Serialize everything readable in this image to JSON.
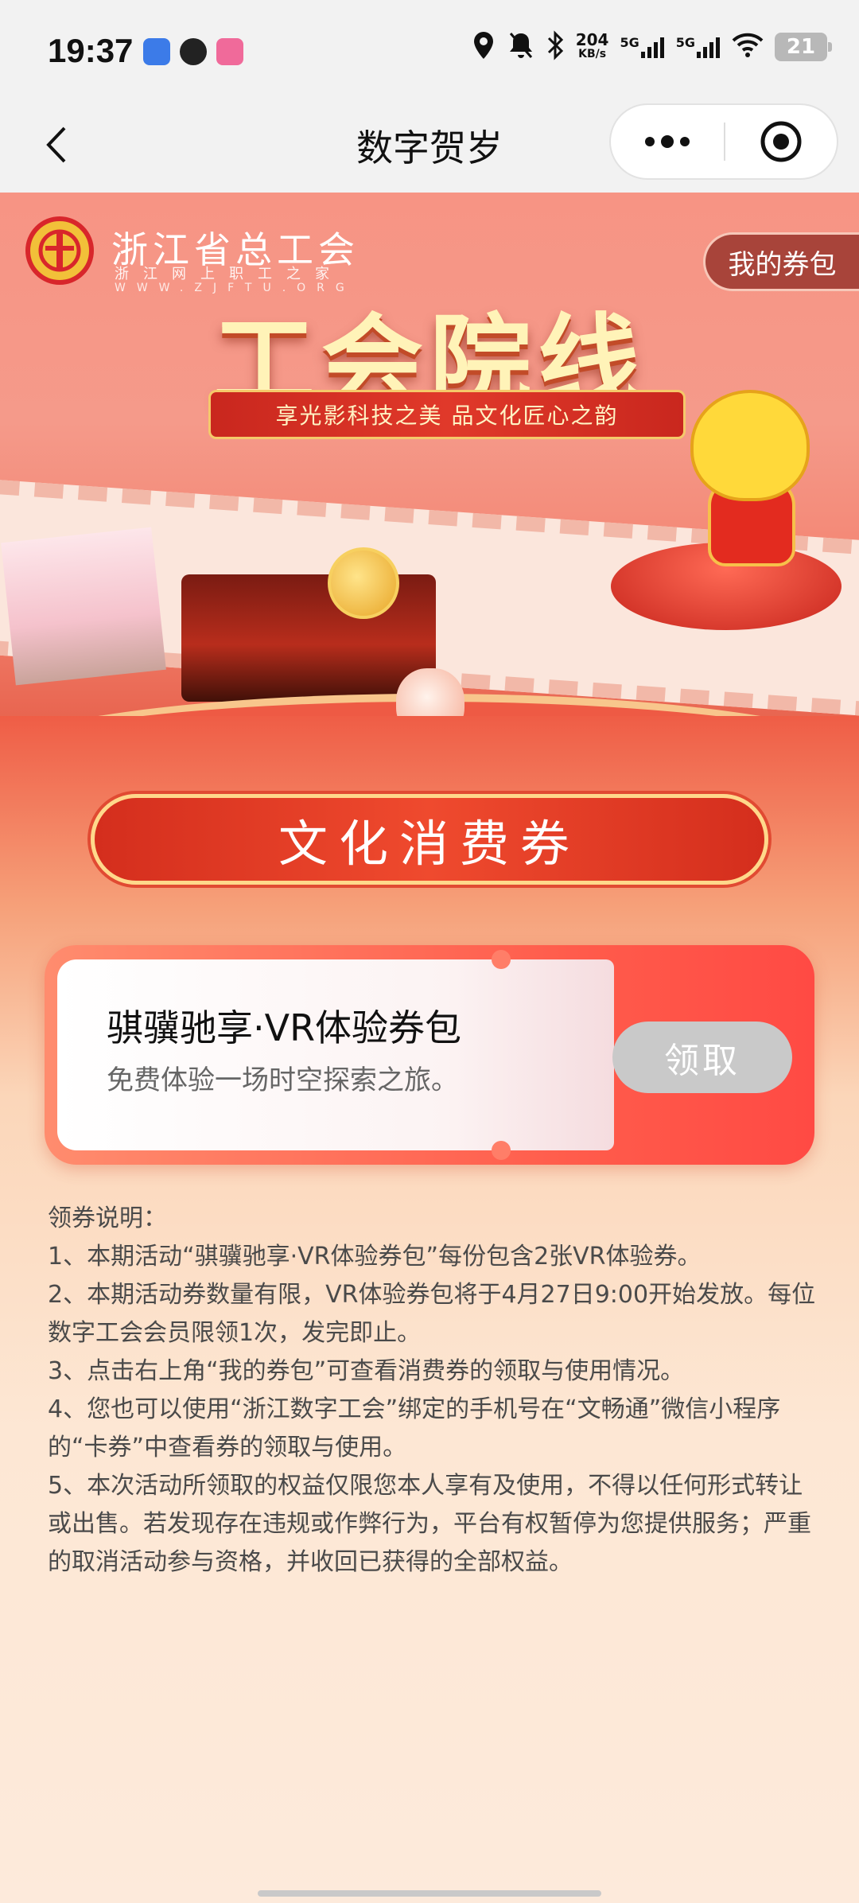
{
  "status_bar": {
    "time": "19:37",
    "network_speed": "204",
    "network_speed_unit": "KB/s",
    "signal_1": "5G",
    "signal_2": "5G",
    "battery": "21"
  },
  "nav": {
    "title": "数字贺岁"
  },
  "banner": {
    "org_name": "浙江省总工会",
    "org_sub": "浙江网上职工之家",
    "org_url": "WWW.ZJFTU.ORG",
    "my_coupons": "我的券包",
    "title": "工会院线",
    "slogan": "享光影科技之美 品文化匠心之韵"
  },
  "section": {
    "title": "文化消费券"
  },
  "coupon": {
    "name": "骐骥驰享·VR体验券包",
    "description": "免费体验一场时空探索之旅。",
    "claim_label": "领取"
  },
  "rules": {
    "heading": "领券说明：",
    "items": [
      "1、本期活动“骐骥驰享·VR体验券包”每份包含2张VR体验券。",
      "2、本期活动券数量有限，VR体验券包将于4月27日9:00开始发放。每位数字工会会员限领1次，发完即止。",
      "3、点击右上角“我的券包”可查看消费券的领取与使用情况。",
      "4、您也可以使用“浙江数字工会”绑定的手机号在“文畅通”微信小程序的“卡券”中查看券的领取与使用。",
      "5、本次活动所领取的权益仅限您本人享有及使用，不得以任何形式转让或出售。若发现存在违规或作弊行为，平台有权暂停为您提供服务；严重的取消活动参与资格，并收回已获得的全部权益。"
    ]
  },
  "colors": {
    "accent_red": "#e0392a",
    "claim_disabled": "#c9c9c9",
    "gold": "#ffd88b"
  }
}
